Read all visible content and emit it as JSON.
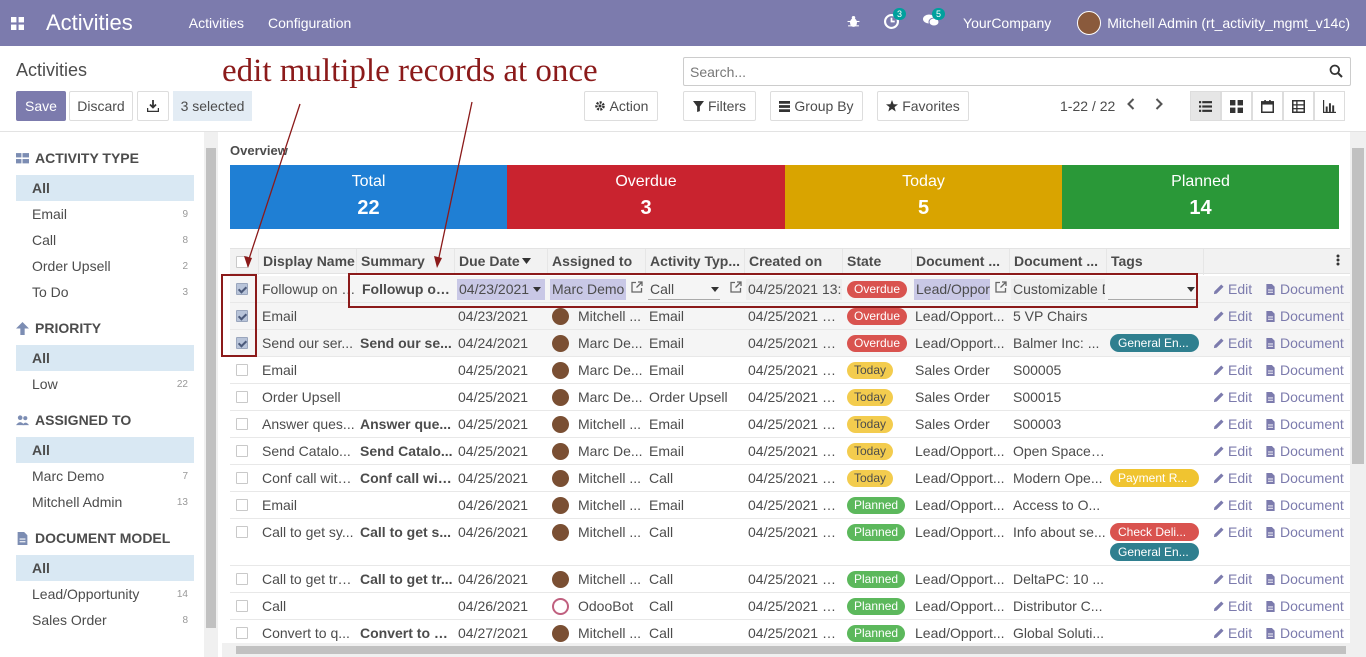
{
  "navbar": {
    "app_title": "Activities",
    "menu": [
      "Activities",
      "Configuration"
    ],
    "activity_badge": "3",
    "messages_badge": "5",
    "company": "YourCompany",
    "user": "Mitchell Admin (rt_activity_mgmt_v14c)"
  },
  "control_panel": {
    "breadcrumb": "Activities",
    "save_label": "Save",
    "discard_label": "Discard",
    "selected_label": "3 selected",
    "action_label": "Action",
    "search_placeholder": "Search...",
    "filters_label": "Filters",
    "groupby_label": "Group By",
    "favorites_label": "Favorites",
    "pager": "1-22 / 22"
  },
  "annotation": {
    "text": "edit multiple records at once"
  },
  "sidebar": {
    "sections": [
      {
        "title": "ACTIVITY TYPE",
        "icon": "grid-icon",
        "items": [
          {
            "label": "All",
            "count": ""
          },
          {
            "label": "Email",
            "count": "9"
          },
          {
            "label": "Call",
            "count": "8"
          },
          {
            "label": "Order Upsell",
            "count": "2"
          },
          {
            "label": "To Do",
            "count": "3"
          }
        ]
      },
      {
        "title": "PRIORITY",
        "icon": "arrow-up-icon",
        "items": [
          {
            "label": "All",
            "count": ""
          },
          {
            "label": "Low",
            "count": "22"
          }
        ]
      },
      {
        "title": "ASSIGNED TO",
        "icon": "users-icon",
        "items": [
          {
            "label": "All",
            "count": ""
          },
          {
            "label": "Marc Demo",
            "count": "7"
          },
          {
            "label": "Mitchell Admin",
            "count": "13"
          }
        ]
      },
      {
        "title": "DOCUMENT MODEL",
        "icon": "file-icon",
        "items": [
          {
            "label": "All",
            "count": ""
          },
          {
            "label": "Lead/Opportunity",
            "count": "14"
          },
          {
            "label": "Sales Order",
            "count": "8"
          }
        ]
      }
    ]
  },
  "overview": {
    "title": "Overview",
    "tiles": [
      {
        "label": "Total",
        "value": "22",
        "color": "#1f7fd4"
      },
      {
        "label": "Overdue",
        "value": "3",
        "color": "#c9232f"
      },
      {
        "label": "Today",
        "value": "5",
        "color": "#d9a400"
      },
      {
        "label": "Planned",
        "value": "14",
        "color": "#2a9838"
      }
    ]
  },
  "grid": {
    "columns": [
      "Display Name",
      "Summary",
      "Due Date",
      "Assigned to",
      "Activity Typ...",
      "Created on",
      "State",
      "Document ...",
      "Document ...",
      "Tags"
    ],
    "edit_label": "Edit",
    "document_label": "Document",
    "edit_row": {
      "display_name": "Followup on the",
      "summary": "Followup on th",
      "due_date": "04/23/2021",
      "assigned_to": "Marc Demo",
      "activity_type": "Call",
      "created_on": "04/25/2021 13:0",
      "state": "Overdue",
      "doc_model": "Lead/Opport",
      "doc_name": "Customizable De"
    },
    "rows": [
      {
        "display_name": "Email",
        "summary": "",
        "due_date": "04/23/2021",
        "assigned_to": "Mitchell ...",
        "avatar": "user",
        "activity_type": "Email",
        "created_on": "04/25/2021 1...",
        "state": "Overdue",
        "doc_model": "Lead/Opport...",
        "doc_name": "5 VP Chairs",
        "tags": [],
        "checked": true
      },
      {
        "display_name": "Send our ser...",
        "summary": "Send our se...",
        "due_date": "04/24/2021",
        "assigned_to": "Marc De...",
        "avatar": "user",
        "activity_type": "Email",
        "created_on": "04/25/2021 1...",
        "state": "Overdue",
        "doc_model": "Lead/Opport...",
        "doc_name": "Balmer Inc: ...",
        "tags": [
          {
            "label": "General En...",
            "color": "teal"
          }
        ],
        "checked": true
      },
      {
        "display_name": "Email",
        "summary": "",
        "due_date": "04/25/2021",
        "assigned_to": "Marc De...",
        "avatar": "user",
        "activity_type": "Email",
        "created_on": "04/25/2021 1...",
        "state": "Today",
        "doc_model": "Sales Order",
        "doc_name": "S00005",
        "tags": [],
        "checked": false
      },
      {
        "display_name": "Order Upsell",
        "summary": "",
        "due_date": "04/25/2021",
        "assigned_to": "Marc De...",
        "avatar": "user",
        "activity_type": "Order Upsell",
        "created_on": "04/25/2021 1...",
        "state": "Today",
        "doc_model": "Sales Order",
        "doc_name": "S00015",
        "tags": [],
        "checked": false
      },
      {
        "display_name": "Answer ques...",
        "summary": "Answer que...",
        "due_date": "04/25/2021",
        "assigned_to": "Mitchell ...",
        "avatar": "user",
        "activity_type": "Email",
        "created_on": "04/25/2021 1...",
        "state": "Today",
        "doc_model": "Sales Order",
        "doc_name": "S00003",
        "tags": [],
        "checked": false
      },
      {
        "display_name": "Send Catalo...",
        "summary": "Send Catalo...",
        "due_date": "04/25/2021",
        "assigned_to": "Marc De...",
        "avatar": "user",
        "activity_type": "Email",
        "created_on": "04/25/2021 1...",
        "state": "Today",
        "doc_model": "Lead/Opport...",
        "doc_name": "Open Space ...",
        "tags": [],
        "checked": false
      },
      {
        "display_name": "Conf call with...",
        "summary": "Conf call wit...",
        "due_date": "04/25/2021",
        "assigned_to": "Mitchell ...",
        "avatar": "user",
        "activity_type": "Call",
        "created_on": "04/25/2021 1...",
        "state": "Today",
        "doc_model": "Lead/Opport...",
        "doc_name": "Modern Ope...",
        "tags": [
          {
            "label": "Payment R...",
            "color": "yellow"
          }
        ],
        "checked": false
      },
      {
        "display_name": "Email",
        "summary": "",
        "due_date": "04/26/2021",
        "assigned_to": "Mitchell ...",
        "avatar": "user",
        "activity_type": "Email",
        "created_on": "04/25/2021 1...",
        "state": "Planned",
        "doc_model": "Lead/Opport...",
        "doc_name": "Access to O...",
        "tags": [],
        "checked": false
      },
      {
        "display_name": "Call to get sy...",
        "summary": "Call to get s...",
        "due_date": "04/26/2021",
        "assigned_to": "Mitchell ...",
        "avatar": "user",
        "activity_type": "Call",
        "created_on": "04/25/2021 1...",
        "state": "Planned",
        "doc_model": "Lead/Opport...",
        "doc_name": "Info about se...",
        "tags": [
          {
            "label": "Check Deli...",
            "color": "red"
          },
          {
            "label": "General En...",
            "color": "teal"
          }
        ],
        "checked": false
      },
      {
        "display_name": "Call to get tra...",
        "summary": "Call to get tr...",
        "due_date": "04/26/2021",
        "assigned_to": "Mitchell ...",
        "avatar": "user",
        "activity_type": "Call",
        "created_on": "04/25/2021 1...",
        "state": "Planned",
        "doc_model": "Lead/Opport...",
        "doc_name": "DeltaPC: 10 ...",
        "tags": [],
        "checked": false
      },
      {
        "display_name": "Call",
        "summary": "",
        "due_date": "04/26/2021",
        "assigned_to": "OdooBot",
        "avatar": "bot",
        "activity_type": "Call",
        "created_on": "04/25/2021 1...",
        "state": "Planned",
        "doc_model": "Lead/Opport...",
        "doc_name": "Distributor C...",
        "tags": [],
        "checked": false
      },
      {
        "display_name": "Convert to q...",
        "summary": "Convert to q...",
        "due_date": "04/27/2021",
        "assigned_to": "Mitchell ...",
        "avatar": "user",
        "activity_type": "Call",
        "created_on": "04/25/2021 1...",
        "state": "Planned",
        "doc_model": "Lead/Opport...",
        "doc_name": "Global Soluti...",
        "tags": [],
        "checked": false
      }
    ]
  }
}
